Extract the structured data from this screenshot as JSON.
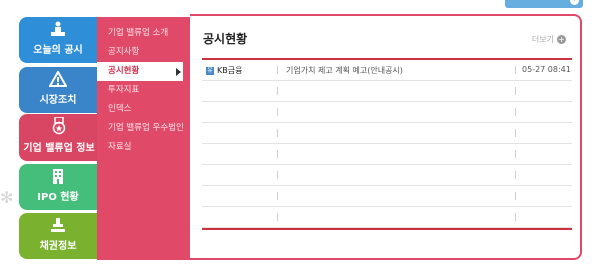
{
  "colors": {
    "blue_primary": "#2f8ed8",
    "pink_accent": "#e04a68",
    "green": "#45be7c",
    "lime": "#7ab12f",
    "red_rule": "#c9323f"
  },
  "top_button": {
    "icon": "arrow-right-icon"
  },
  "categories": [
    {
      "label": "오늘의 공시",
      "icon": "podium-person-icon"
    },
    {
      "label": "시장조치",
      "icon": "warning-triangle-icon"
    },
    {
      "label": "기업 밸류업 정보",
      "icon": "medal-icon"
    },
    {
      "label": "IPO 현황",
      "icon": "building-icon"
    },
    {
      "label": "채권정보",
      "icon": "stamp-icon"
    }
  ],
  "submenu": {
    "items": [
      "기업 밸류업 소개",
      "공지사항",
      "공시현황",
      "투자지표",
      "인덱스",
      "기업 밸류업 우수법인",
      "자료실"
    ],
    "active_index": 2
  },
  "panel": {
    "title": "공시현황",
    "more_label": "더보기",
    "rows": [
      {
        "company": "KB금융",
        "title": "기업가치 제고 계획 예고(안내공시)",
        "time": "05-27 08:41"
      },
      {
        "company": "",
        "title": "",
        "time": ""
      },
      {
        "company": "",
        "title": "",
        "time": ""
      },
      {
        "company": "",
        "title": "",
        "time": ""
      },
      {
        "company": "",
        "title": "",
        "time": ""
      },
      {
        "company": "",
        "title": "",
        "time": ""
      },
      {
        "company": "",
        "title": "",
        "time": ""
      },
      {
        "company": "",
        "title": "",
        "time": ""
      }
    ]
  }
}
